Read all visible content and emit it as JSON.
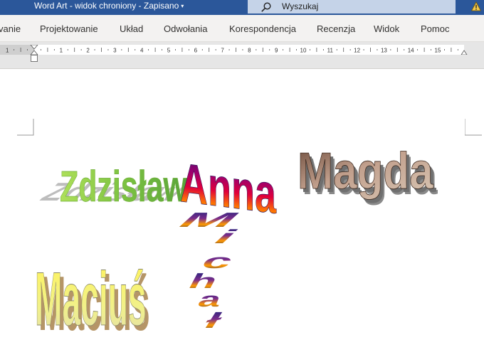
{
  "titlebar": {
    "doc_name": "Word Art",
    "sep1": "-",
    "mode": "widok chroniony",
    "sep2": "-",
    "status": "Zapisano",
    "chevron": "▾"
  },
  "search": {
    "placeholder": "Wyszukaj"
  },
  "menu": [
    "vanie",
    "Projektowanie",
    "Układ",
    "Odwołania",
    "Korespondencja",
    "Recenzja",
    "Widok",
    "Pomoc"
  ],
  "ruler": {
    "marks": [
      "1",
      "1",
      "2",
      "3",
      "4",
      "5",
      "6",
      "7",
      "8",
      "9",
      "10",
      "11",
      "12",
      "13",
      "14",
      "15"
    ]
  },
  "wordart": {
    "zdzislaw": "Zdzisław",
    "anna": "Anna",
    "magda": "Magda",
    "macius": "Maciuś",
    "michal": [
      "M",
      "i",
      "c",
      "h",
      "a",
      "ł"
    ]
  },
  "colors": {
    "title_bar": "#2b579a",
    "ribbon": "#f3f2f1",
    "ruler_bg": "#e6e6e6"
  }
}
